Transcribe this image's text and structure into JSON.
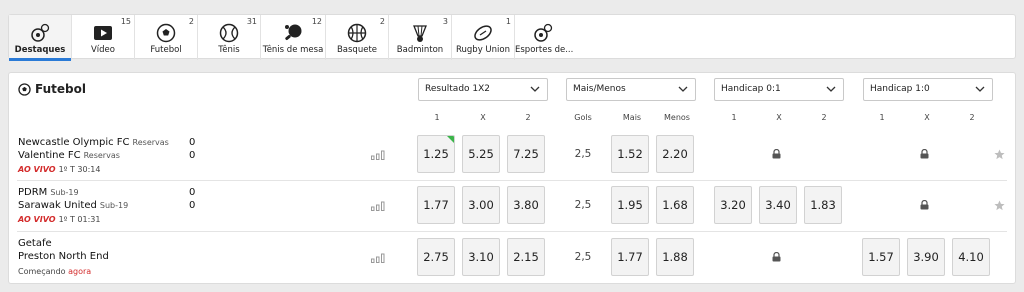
{
  "tabs": [
    {
      "label": "Destaques",
      "count": "",
      "icon": "featured-icon",
      "active": true
    },
    {
      "label": "Vídeo",
      "count": "15",
      "icon": "video-icon"
    },
    {
      "label": "Futebol",
      "count": "2",
      "icon": "soccer-ball-icon"
    },
    {
      "label": "Tênis",
      "count": "31",
      "icon": "tennis-ball-icon"
    },
    {
      "label": "Tênis de mesa",
      "count": "12",
      "icon": "table-tennis-icon"
    },
    {
      "label": "Basquete",
      "count": "2",
      "icon": "basketball-icon"
    },
    {
      "label": "Badminton",
      "count": "3",
      "icon": "shuttlecock-icon"
    },
    {
      "label": "Rugby Union",
      "count": "1",
      "icon": "rugby-ball-icon"
    },
    {
      "label": "Esportes de...",
      "count": "",
      "icon": "more-sports-icon"
    }
  ],
  "panel": {
    "title": "Futebol",
    "markets": [
      {
        "label": "Resultado 1X2",
        "headers": [
          "1",
          "X",
          "2"
        ]
      },
      {
        "label": "Mais/Menos",
        "headers": [
          "Gols",
          "Mais",
          "Menos"
        ]
      },
      {
        "label": "Handicap 0:1",
        "headers": [
          "1",
          "X",
          "2"
        ]
      },
      {
        "label": "Handicap 1:0",
        "headers": [
          "1",
          "X",
          "2"
        ]
      }
    ]
  },
  "events": [
    {
      "home": "Newcastle Olympic FC",
      "home_sub": "Reservas",
      "home_score": "0",
      "away": "Valentine FC",
      "away_sub": "Reservas",
      "away_score": "0",
      "live_label": "AO VIVO",
      "status": "1º T 30:14",
      "result": [
        "1.25",
        "5.25",
        "7.25"
      ],
      "totals": {
        "line": "2,5",
        "over": "1.52",
        "under": "2.20"
      },
      "handicap_a": null,
      "handicap_b": null
    },
    {
      "home": "PDRM",
      "home_sub": "Sub-19",
      "home_score": "0",
      "away": "Sarawak United",
      "away_sub": "Sub-19",
      "away_score": "0",
      "live_label": "AO VIVO",
      "status": "1º T 01:31",
      "result": [
        "1.77",
        "3.00",
        "3.80"
      ],
      "totals": {
        "line": "2,5",
        "over": "1.95",
        "under": "1.68"
      },
      "handicap_a": [
        "3.20",
        "3.40",
        "1.83"
      ],
      "handicap_b": null
    },
    {
      "home": "Getafe",
      "home_sub": "",
      "home_score": "",
      "away": "Preston North End",
      "away_sub": "",
      "away_score": "",
      "status_prefix": "Começando",
      "status_now": "agora",
      "result": [
        "2.75",
        "3.10",
        "2.15"
      ],
      "totals": {
        "line": "2,5",
        "over": "1.77",
        "under": "1.88"
      },
      "handicap_a": null,
      "handicap_b": [
        "1.57",
        "3.90",
        "4.10"
      ]
    }
  ],
  "colors": {
    "accent": "#2a7ad6",
    "live": "#d32b2b",
    "flag": "#3bb54a"
  }
}
